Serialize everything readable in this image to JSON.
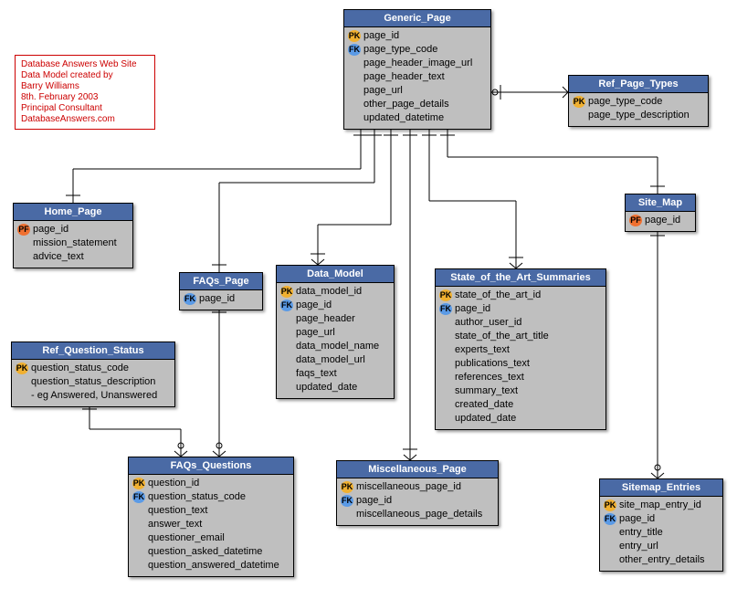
{
  "info": {
    "line1": "Database Answers Web Site",
    "line2": "Data Model created by",
    "line3": "Barry Williams",
    "line4": "8th. February 2003",
    "line5": "Principal Consultant",
    "line6": "DatabaseAnswers.com"
  },
  "entities": {
    "generic_page": {
      "title": "Generic_Page",
      "attrs": [
        {
          "key": "PK",
          "name": "page_id"
        },
        {
          "key": "FK",
          "name": "page_type_code"
        },
        {
          "key": "",
          "name": "page_header_image_url"
        },
        {
          "key": "",
          "name": "page_header_text"
        },
        {
          "key": "",
          "name": "page_url"
        },
        {
          "key": "",
          "name": "other_page_details"
        },
        {
          "key": "",
          "name": "updated_datetime"
        }
      ]
    },
    "ref_page_types": {
      "title": "Ref_Page_Types",
      "attrs": [
        {
          "key": "PK",
          "name": "page_type_code"
        },
        {
          "key": "",
          "name": "page_type_description"
        }
      ]
    },
    "home_page": {
      "title": "Home_Page",
      "attrs": [
        {
          "key": "PF",
          "name": "page_id"
        },
        {
          "key": "",
          "name": "mission_statement"
        },
        {
          "key": "",
          "name": "advice_text"
        }
      ]
    },
    "faqs_page": {
      "title": "FAQs_Page",
      "attrs": [
        {
          "key": "FK",
          "name": "page_id"
        }
      ]
    },
    "data_model": {
      "title": "Data_Model",
      "attrs": [
        {
          "key": "PK",
          "name": "data_model_id"
        },
        {
          "key": "FK",
          "name": "page_id"
        },
        {
          "key": "",
          "name": "page_header"
        },
        {
          "key": "",
          "name": "page_url"
        },
        {
          "key": "",
          "name": "data_model_name"
        },
        {
          "key": "",
          "name": "data_model_url"
        },
        {
          "key": "",
          "name": "faqs_text"
        },
        {
          "key": "",
          "name": "updated_date"
        }
      ]
    },
    "sota": {
      "title": "State_of_the_Art_Summaries",
      "attrs": [
        {
          "key": "PK",
          "name": "state_of_the_art_id"
        },
        {
          "key": "FK",
          "name": "page_id"
        },
        {
          "key": "",
          "name": "author_user_id"
        },
        {
          "key": "",
          "name": "state_of_the_art_title"
        },
        {
          "key": "",
          "name": "experts_text"
        },
        {
          "key": "",
          "name": "publications_text"
        },
        {
          "key": "",
          "name": "references_text"
        },
        {
          "key": "",
          "name": "summary_text"
        },
        {
          "key": "",
          "name": "created_date"
        },
        {
          "key": "",
          "name": "updated_date"
        }
      ]
    },
    "site_map": {
      "title": "Site_Map",
      "attrs": [
        {
          "key": "PF",
          "name": "page_id"
        }
      ]
    },
    "ref_question_status": {
      "title": "Ref_Question_Status",
      "attrs": [
        {
          "key": "PK",
          "name": "question_status_code"
        },
        {
          "key": "",
          "name": "question_status_description"
        },
        {
          "key": "",
          "name": "- eg Answered, Unanswered"
        }
      ]
    },
    "faqs_questions": {
      "title": "FAQs_Questions",
      "attrs": [
        {
          "key": "PK",
          "name": "question_id"
        },
        {
          "key": "FK",
          "name": "question_status_code"
        },
        {
          "key": "",
          "name": "question_text"
        },
        {
          "key": "",
          "name": "answer_text"
        },
        {
          "key": "",
          "name": "questioner_email"
        },
        {
          "key": "",
          "name": "question_asked_datetime"
        },
        {
          "key": "",
          "name": "question_answered_datetime"
        }
      ]
    },
    "misc_page": {
      "title": "Miscellaneous_Page",
      "attrs": [
        {
          "key": "PK",
          "name": "miscellaneous_page_id"
        },
        {
          "key": "FK",
          "name": "page_id"
        },
        {
          "key": "",
          "name": "miscellaneous_page_details"
        }
      ]
    },
    "sitemap_entries": {
      "title": "Sitemap_Entries",
      "attrs": [
        {
          "key": "PK",
          "name": "site_map_entry_id"
        },
        {
          "key": "FK",
          "name": "page_id"
        },
        {
          "key": "",
          "name": "entry_title"
        },
        {
          "key": "",
          "name": "entry_url"
        },
        {
          "key": "",
          "name": "other_entry_details"
        }
      ]
    }
  }
}
